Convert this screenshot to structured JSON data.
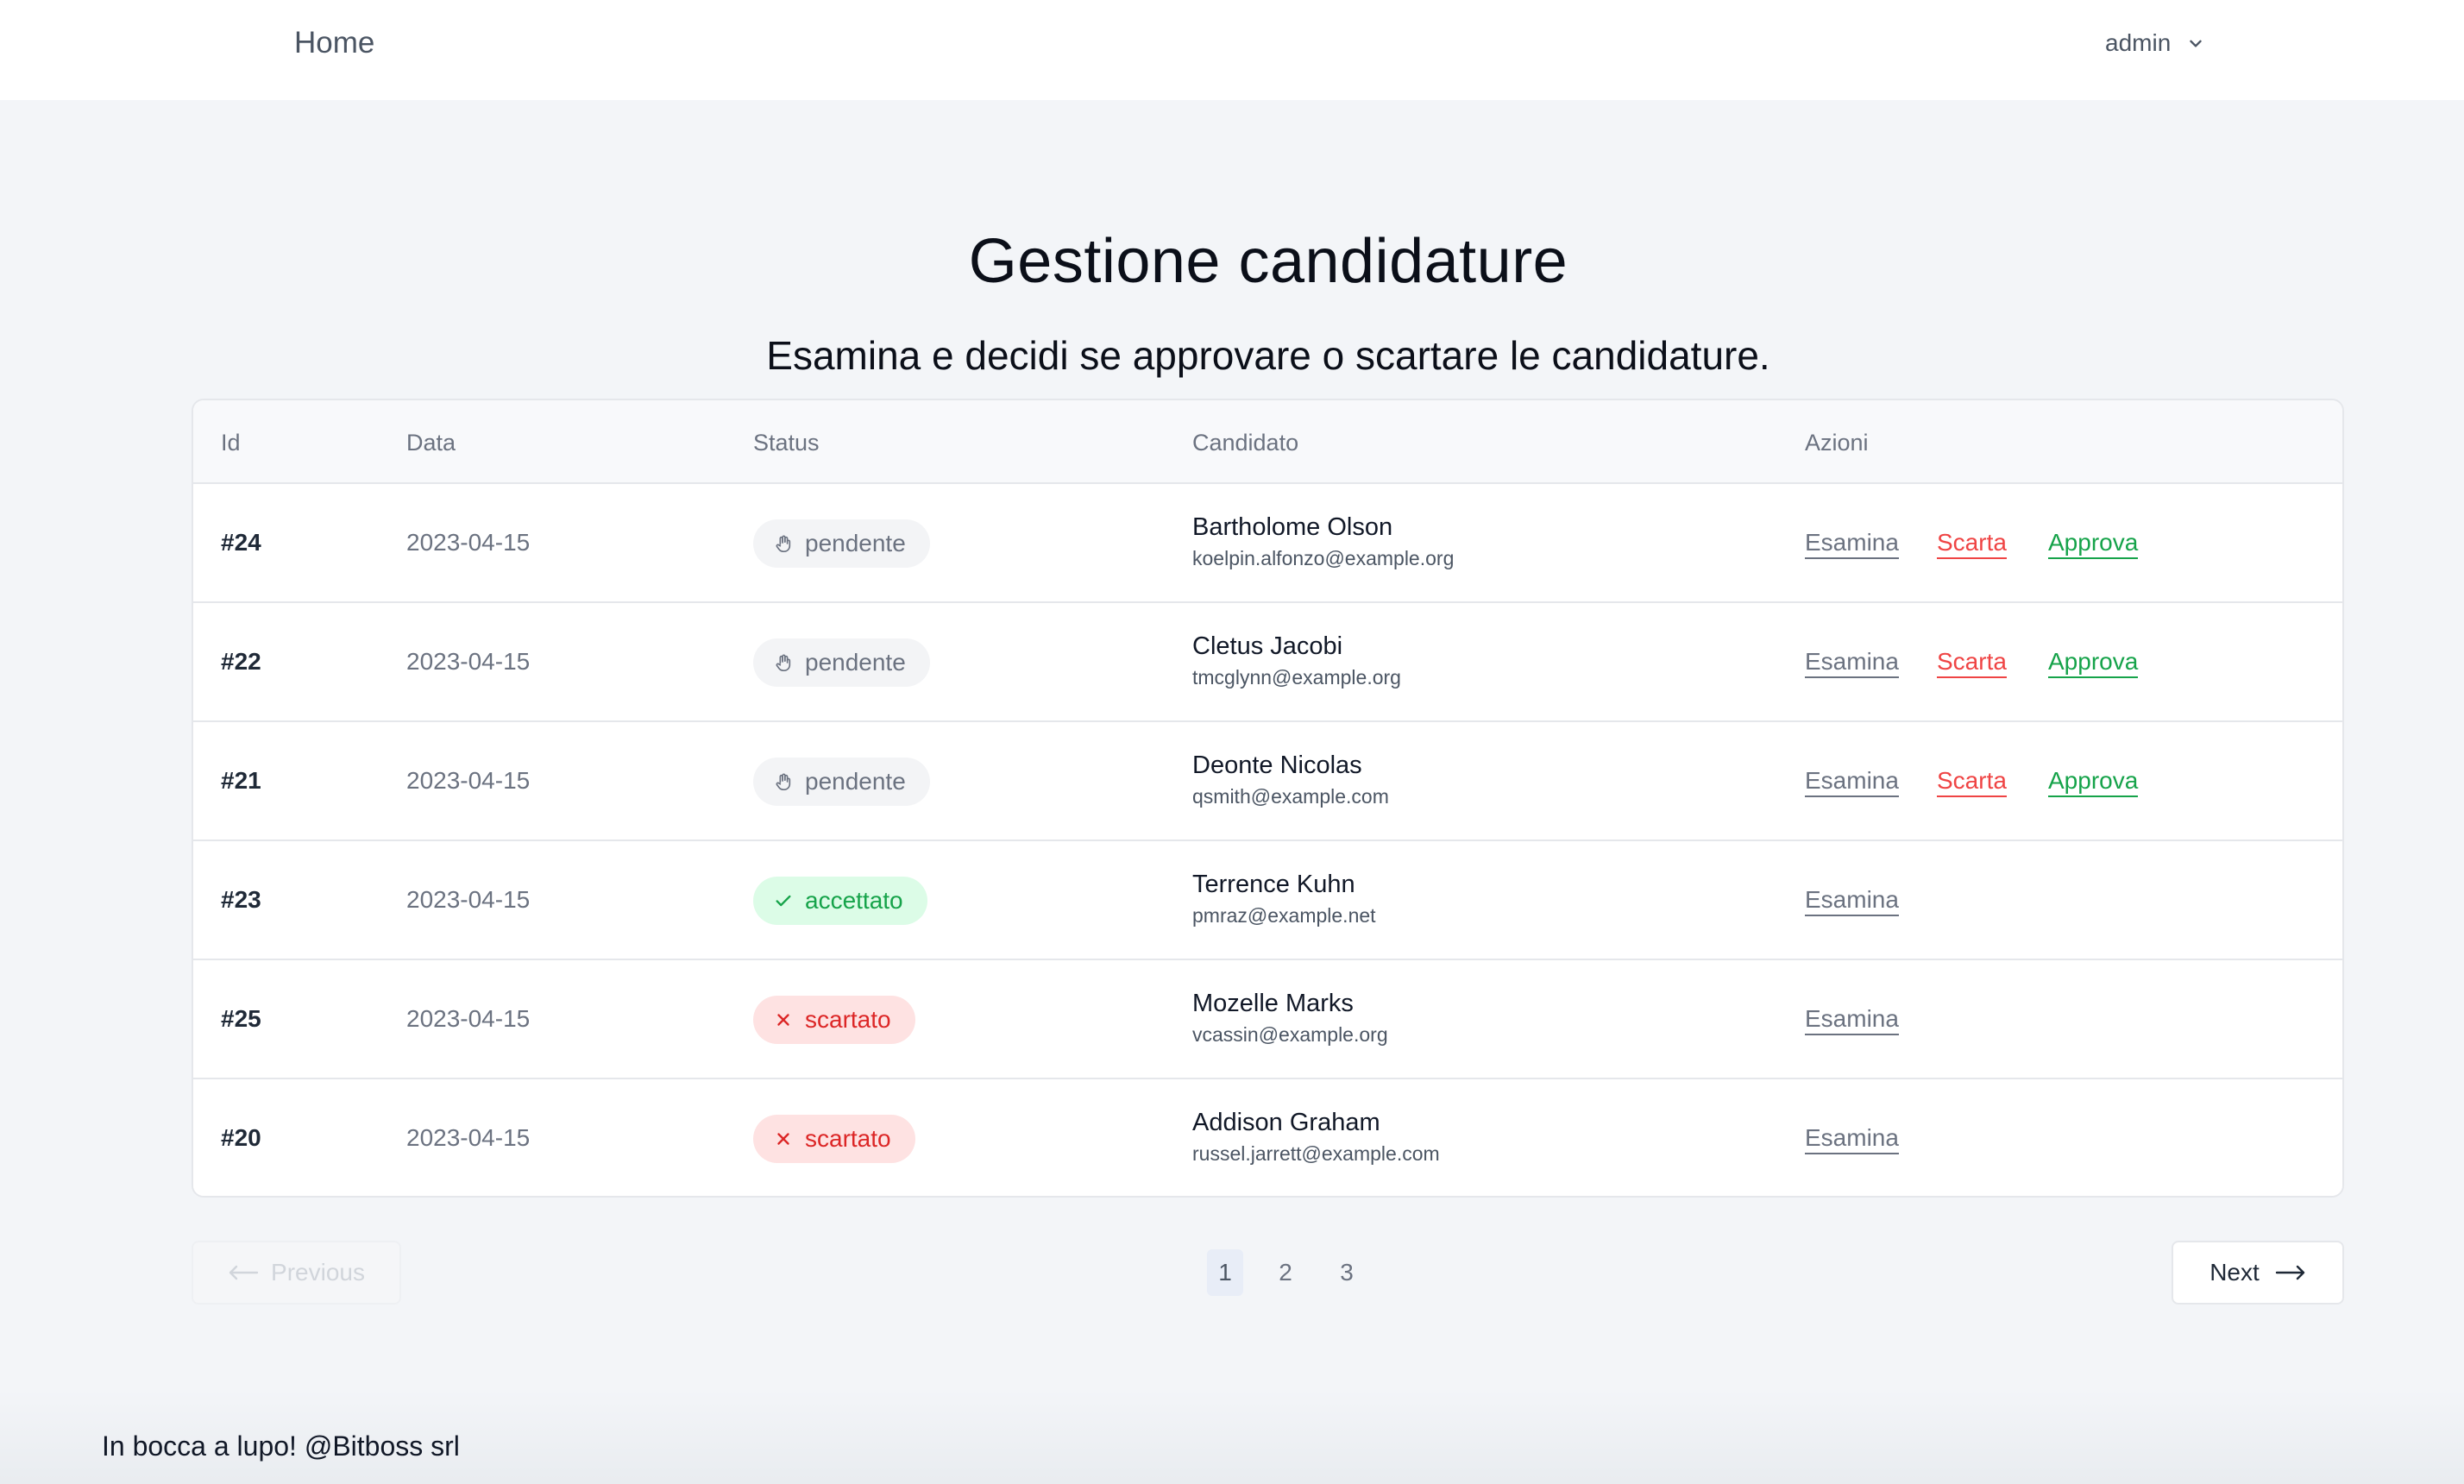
{
  "nav": {
    "home_label": "Home",
    "user_label": "admin",
    "user_menu_icon": "chevron-down-icon"
  },
  "page": {
    "title": "Gestione candidature",
    "subtitle": "Esamina e decidi se approvare o scartare le candidature."
  },
  "table": {
    "headers": [
      "Id",
      "Data",
      "Status",
      "Candidato",
      "Azioni"
    ],
    "rows": [
      {
        "id": "#24",
        "date": "2023-04-15",
        "status": "pendente",
        "status_type": "pending",
        "name": "Bartholome Olson",
        "email": "koelpin.alfonzo@example.org",
        "actions": [
          "Esamina",
          "Scarta",
          "Approva"
        ]
      },
      {
        "id": "#22",
        "date": "2023-04-15",
        "status": "pendente",
        "status_type": "pending",
        "name": "Cletus Jacobi",
        "email": "tmcglynn@example.org",
        "actions": [
          "Esamina",
          "Scarta",
          "Approva"
        ]
      },
      {
        "id": "#21",
        "date": "2023-04-15",
        "status": "pendente",
        "status_type": "pending",
        "name": "Deonte Nicolas",
        "email": "qsmith@example.com",
        "actions": [
          "Esamina",
          "Scarta",
          "Approva"
        ]
      },
      {
        "id": "#23",
        "date": "2023-04-15",
        "status": "accettato",
        "status_type": "accepted",
        "name": "Terrence Kuhn",
        "email": "pmraz@example.net",
        "actions": [
          "Esamina"
        ]
      },
      {
        "id": "#25",
        "date": "2023-04-15",
        "status": "scartato",
        "status_type": "rejected",
        "name": "Mozelle Marks",
        "email": "vcassin@example.org",
        "actions": [
          "Esamina"
        ]
      },
      {
        "id": "#20",
        "date": "2023-04-15",
        "status": "scartato",
        "status_type": "rejected",
        "name": "Addison Graham",
        "email": "russel.jarrett@example.com",
        "actions": [
          "Esamina"
        ]
      }
    ]
  },
  "pagination": {
    "previous_label": "Previous",
    "next_label": "Next",
    "pages": [
      "1",
      "2",
      "3"
    ],
    "current_page": "1"
  },
  "footer": {
    "text": "In bocca a lupo! @Bitboss srl"
  },
  "colors": {
    "background": "#f3f5f8",
    "pending": "#6b7280",
    "accepted": "#16a34a",
    "rejected": "#dc2626"
  }
}
